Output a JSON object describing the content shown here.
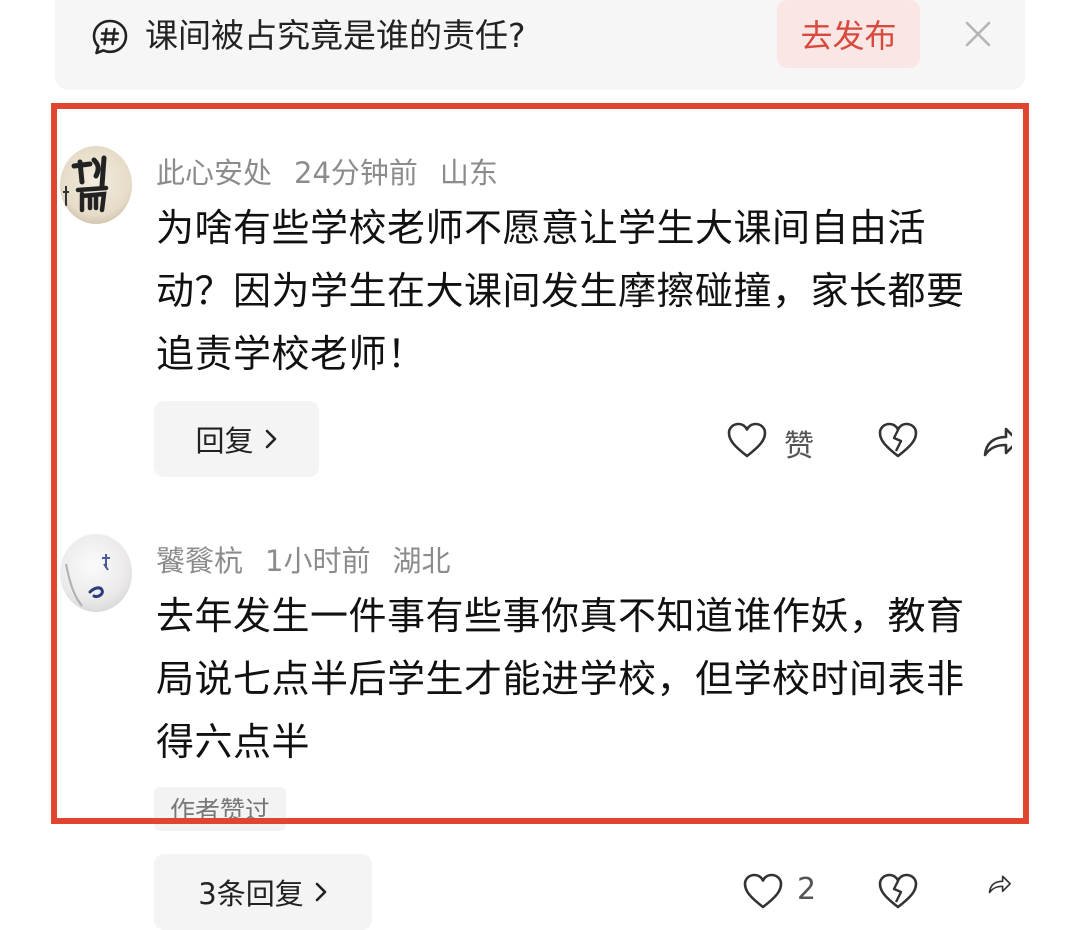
{
  "topic": {
    "title": "课间被占究竟是谁的责任?",
    "publish_label": "去发布"
  },
  "comments": [
    {
      "username": "此心安处",
      "time": "24分钟前",
      "location": "山东",
      "text": "为啥有些学校老师不愿意让学生大课间自由活动？因为学生在大课间发生摩擦碰撞，家长都要追责学校老师！",
      "reply_label": "回复",
      "like_label": "赞"
    },
    {
      "username": "饕餮杭",
      "time": "1小时前",
      "location": "湖北",
      "text": "去年发生一件事有些事你真不知道谁作妖，教育局说七点半后学生才能进学校，但学校时间表非得六点半",
      "badge": "作者赞过",
      "reply_label": "3条回复",
      "like_count": "2"
    }
  ],
  "colors": {
    "accent": "#d8493e",
    "highlight": "#e0462f"
  },
  "icons": [
    "topic-hash-icon",
    "close-icon",
    "heart-icon",
    "broken-heart-icon",
    "share-icon",
    "chevron-right-icon"
  ]
}
